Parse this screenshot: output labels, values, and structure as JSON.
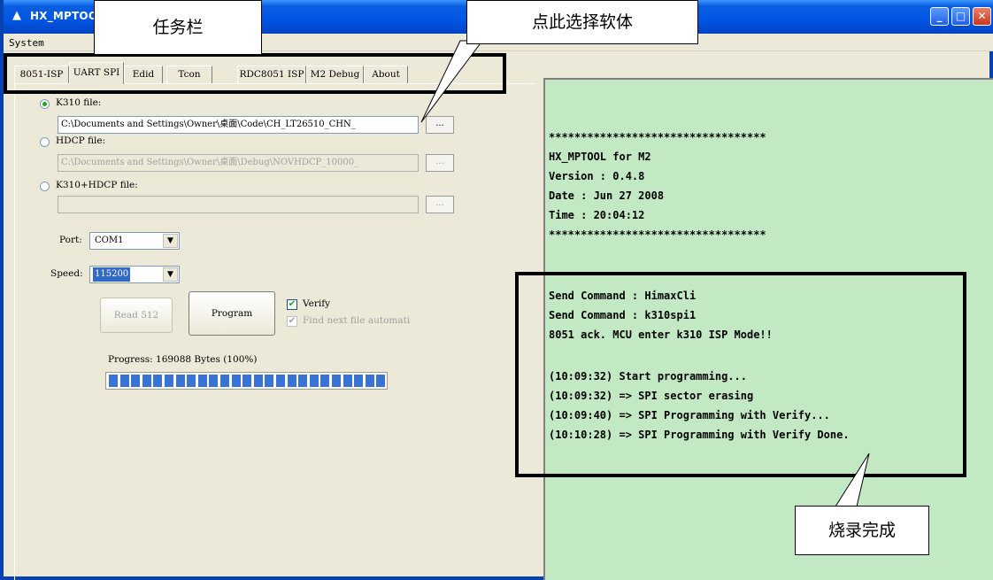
{
  "window": {
    "title": "HX_MPTOOL",
    "menu": [
      "System"
    ],
    "controls": [
      "minimize",
      "maximize",
      "close"
    ]
  },
  "tabs": [
    {
      "label": "8051-ISP",
      "active": false
    },
    {
      "label": "UART SPI",
      "active": true
    },
    {
      "label": "Edid",
      "active": false
    },
    {
      "label": "Tcon",
      "active": false
    },
    {
      "label": "RDC8051 ISP",
      "active": false
    },
    {
      "label": "M2 Debug",
      "active": false
    },
    {
      "label": "About",
      "active": false
    }
  ],
  "file_options": {
    "k310": {
      "label": "K310 file:",
      "selected": true,
      "path": "C:\\Documents and Settings\\Owner\\桌面\\Code\\CH_LT26510_CHN_",
      "browse": "...",
      "enabled": true
    },
    "hdcp": {
      "label": "HDCP file:",
      "selected": false,
      "path": "C:\\Documents and Settings\\Owner\\桌面\\Debug\\NOVHDCP_10000_",
      "browse": "...",
      "enabled": false
    },
    "k310_hdcp": {
      "label": "K310+HDCP file:",
      "selected": false,
      "path": "",
      "browse": "...",
      "enabled": false
    }
  },
  "port": {
    "label": "Port:",
    "value": "COM1"
  },
  "speed": {
    "label": "Speed:",
    "value": "115200"
  },
  "buttons": {
    "read": "Read 512",
    "program": "Program"
  },
  "options": {
    "verify": {
      "label": "Verify",
      "checked": true
    },
    "find_next": {
      "label": "Find next file automati",
      "checked": true,
      "enabled": false
    }
  },
  "progress": {
    "label": "Progress: 169088 Bytes (100%)",
    "percent": 100
  },
  "log": [
    "**********************************",
    "HX_MPTOOL for M2",
    "Version : 0.4.8",
    "Date : Jun 27 2008",
    "Time : 20:04:12",
    "**********************************",
    "",
    "",
    "Send Command : HimaxCli",
    "Send Command : k310spi1",
    "8051 ack. MCU enter k310 ISP Mode!!",
    "",
    "(10:09:32) Start programming...",
    "(10:09:32) => SPI sector erasing",
    "(10:09:40) => SPI Programming with Verify...",
    "(10:10:28) => SPI Programming with Verify Done."
  ],
  "annotations": {
    "taskbar": "任务栏",
    "select_firmware": "点此选择软体",
    "burn_done": "烧录完成"
  },
  "colors": {
    "title_bar": "#0055e5",
    "log_bg": "#c2e9c3",
    "progress_fill": "#3a73d6"
  }
}
